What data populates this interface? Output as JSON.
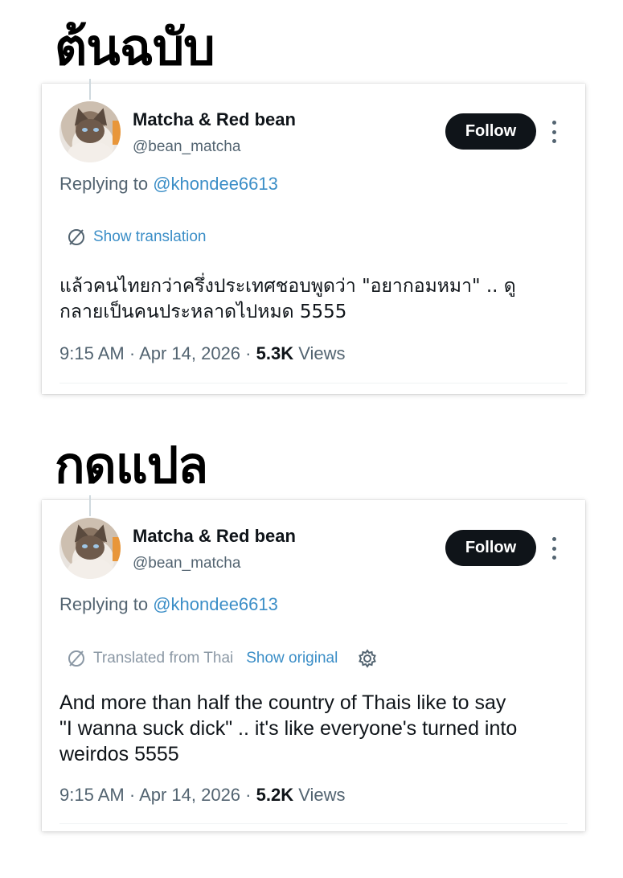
{
  "labels": {
    "original": "ต้นฉบับ",
    "translated": "กดแปล"
  },
  "tweets": [
    {
      "display_name": "Matcha & Red bean",
      "handle": "@bean_matcha",
      "follow_label": "Follow",
      "replying_prefix": "Replying to ",
      "replying_to": "@khondee6613",
      "translation_link": "Show translation",
      "text": "แล้วคนไทยกว่าครึ่งประเทศชอบพูดว่า \"อยากอมหมา\" .. ดู\nกลายเป็นคนประหลาดไปหมด 5555",
      "time": "9:15 AM",
      "date": "Apr 14, 2026",
      "views_count": "5.3K",
      "views_label": "Views"
    },
    {
      "display_name": "Matcha & Red bean",
      "handle": "@bean_matcha",
      "follow_label": "Follow",
      "replying_prefix": "Replying to ",
      "replying_to": "@khondee6613",
      "translated_from": "Translated from Thai",
      "show_original": "Show original",
      "text": "And more than half the country of Thais like to say\n\"I wanna suck dick\" .. it's like everyone's turned into\nweirdos 5555",
      "time": "9:15 AM",
      "date": "Apr 14, 2026",
      "views_count": "5.2K",
      "views_label": "Views"
    }
  ],
  "colors": {
    "link": "#3b8ec7",
    "follow_bg": "#0f1419",
    "muted": "#536471"
  },
  "icons": [
    "globe-icon",
    "gear-icon",
    "more-icon"
  ]
}
